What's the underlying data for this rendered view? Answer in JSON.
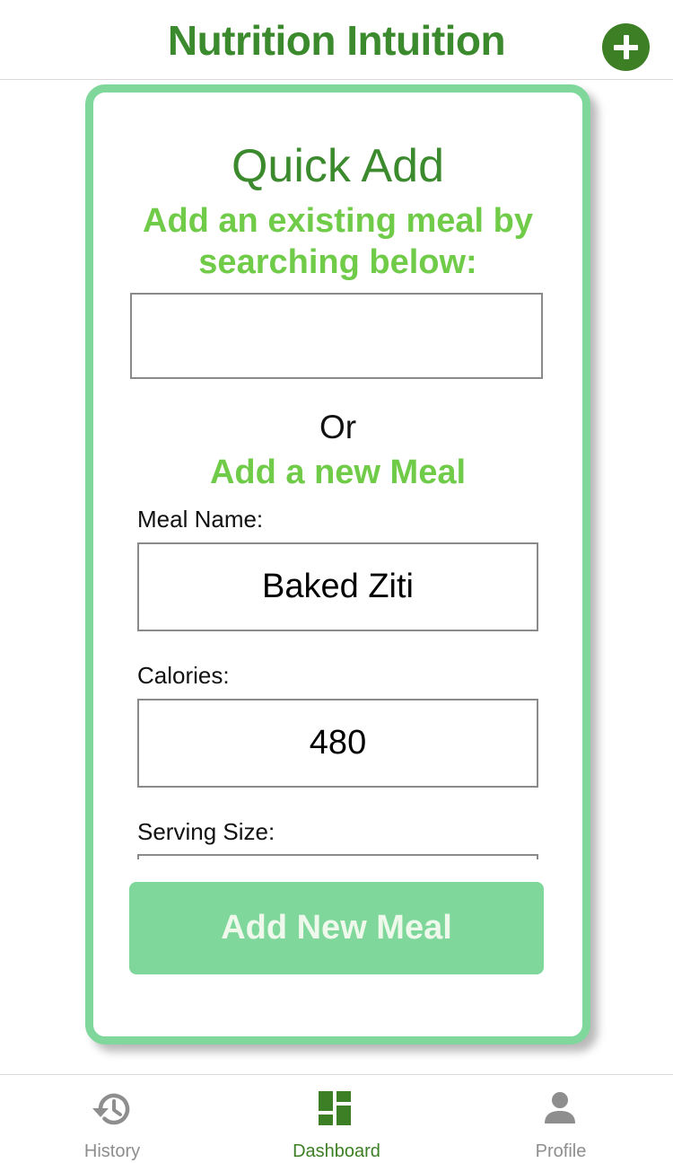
{
  "app": {
    "title": "Nutrition Intuition"
  },
  "colors": {
    "brand_dark": "#3c8a2e",
    "brand_light": "#6fcb48",
    "accent_mint": "#7fd79b",
    "inactive_gray": "#8e8e8e"
  },
  "quick_add": {
    "title": "Quick Add",
    "subtitle": "Add an existing meal by searching below:",
    "search_value": "",
    "or_text": "Or",
    "new_meal_heading": "Add a new Meal"
  },
  "form": {
    "meal_name_label": "Meal Name:",
    "meal_name_value": "Baked Ziti",
    "calories_label": "Calories:",
    "calories_value": "480",
    "serving_size_label": "Serving Size:",
    "submit_label": "Add New Meal"
  },
  "tabs": [
    {
      "label": "History",
      "icon": "history-icon",
      "active": false
    },
    {
      "label": "Dashboard",
      "icon": "dashboard-icon",
      "active": true
    },
    {
      "label": "Profile",
      "icon": "person-icon",
      "active": false
    }
  ]
}
